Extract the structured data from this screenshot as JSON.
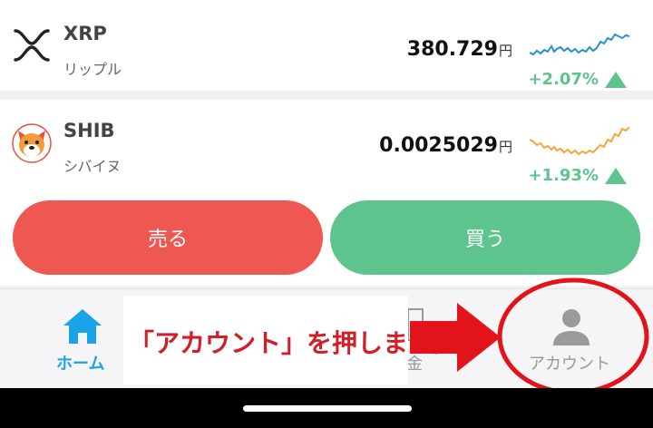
{
  "coins": [
    {
      "symbol": "XRP",
      "name": "リップル",
      "price": "380.729",
      "unit": "円",
      "change": "+2.07%",
      "spark_color": "#2a8fc7"
    },
    {
      "symbol": "SHIB",
      "name": "シバイヌ",
      "price": "0.0025029",
      "unit": "円",
      "change": "+1.93%",
      "spark_color": "#f0a83a"
    }
  ],
  "actions": {
    "sell": "売る",
    "buy": "買う"
  },
  "nav": {
    "home": "ホーム",
    "account": "アカウント",
    "partial": "金"
  },
  "callout": {
    "text": "「アカウント」を押します。"
  },
  "colors": {
    "sell": "#ef5752",
    "buy": "#5ec48e",
    "home_active": "#1aa3e8",
    "callout": "#d11f2a"
  }
}
